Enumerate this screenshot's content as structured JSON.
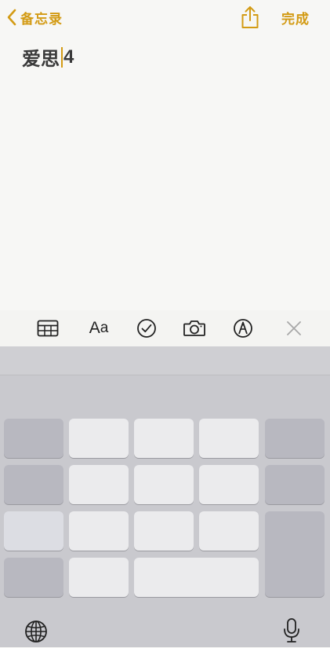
{
  "nav": {
    "back_label": "备忘录",
    "share_icon": "share-icon",
    "done_label": "完成"
  },
  "note": {
    "text_before_cursor": "爱思",
    "text_after_cursor": "4"
  },
  "toolbar": {
    "table_icon": "table-icon",
    "format_label_big": "A",
    "format_label_small": "a",
    "checklist_icon": "checkmark-circle-icon",
    "camera_icon": "camera-icon",
    "markup_icon": "markup-pen-icon",
    "close_icon": "close-icon"
  },
  "keyboard": {
    "globe_icon": "globe-icon",
    "mic_icon": "microphone-icon"
  },
  "colors": {
    "accent": "#d39b14",
    "background": "#f7f7f5",
    "keyboard_bg": "#c9c9ce",
    "key_light": "#ebebed",
    "key_dark": "#b8b8c0"
  }
}
